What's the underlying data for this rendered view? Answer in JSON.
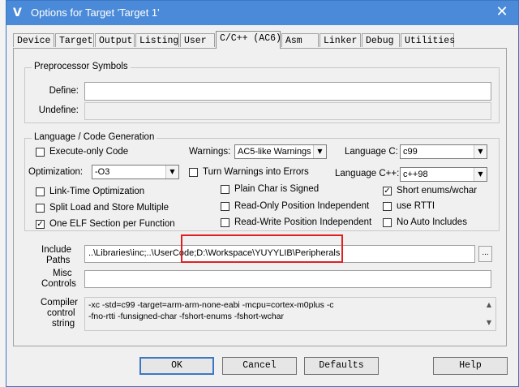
{
  "window": {
    "title": "Options for Target 'Target 1'",
    "close_glyph": "✕",
    "app_icon_glyph": "V"
  },
  "tabs": [
    "Device",
    "Target",
    "Output",
    "Listing",
    "User",
    "C/C++ (AC6)",
    "Asm",
    "Linker",
    "Debug",
    "Utilities"
  ],
  "preprocessor": {
    "group_title": "Preprocessor Symbols",
    "define_label": "Define:",
    "define_value": "",
    "undefine_label": "Undefine:",
    "undefine_value": ""
  },
  "language": {
    "group_title": "Language / Code Generation",
    "execute_only": {
      "label": "Execute-only Code",
      "checked": false
    },
    "optimization_label": "Optimization:",
    "optimization_value": "-O3",
    "link_time": {
      "label": "Link-Time Optimization",
      "checked": false
    },
    "split_load": {
      "label": "Split Load and Store Multiple",
      "checked": false
    },
    "one_elf": {
      "label": "One ELF Section per Function",
      "checked": true
    },
    "warnings_label": "Warnings:",
    "warnings_value": "AC5-like Warnings",
    "turn_warnings": {
      "label": "Turn Warnings into Errors",
      "checked": false
    },
    "plain_char": {
      "label": "Plain Char is Signed",
      "checked": false
    },
    "ropi": {
      "label": "Read-Only Position Independent",
      "checked": false
    },
    "rwpi": {
      "label": "Read-Write Position Independent",
      "checked": false
    },
    "language_c_label": "Language C:",
    "language_c_value": "c99",
    "language_cpp_label": "Language C++:",
    "language_cpp_value": "c++98",
    "short_enums": {
      "label": "Short enums/wchar",
      "checked": true
    },
    "use_rtti": {
      "label": "use RTTI",
      "checked": false
    },
    "no_auto_includes": {
      "label": "No Auto Includes",
      "checked": false
    }
  },
  "include_paths": {
    "label_line1": "Include",
    "label_line2": "Paths",
    "value": "..\\Libraries\\inc;..\\UserCode;D:\\Workspace\\YUYYLIB\\Peripherals",
    "browse_label": "..."
  },
  "misc_controls": {
    "label_line1": "Misc",
    "label_line2": "Controls",
    "value": ""
  },
  "compiler_control": {
    "label_line1": "Compiler",
    "label_line2": "control",
    "label_line3": "string",
    "line1": "-xc -std=c99 -target=arm-arm-none-eabi -mcpu=cortex-m0plus -c",
    "line2": "-fno-rtti -funsigned-char -fshort-enums -fshort-wchar",
    "scroll_up": "▲",
    "scroll_down": "▼"
  },
  "buttons": {
    "ok": "OK",
    "cancel": "Cancel",
    "defaults": "Defaults",
    "help": "Help"
  },
  "colors": {
    "titlebar": "#4a8ad8",
    "highlight": "#e02020"
  }
}
